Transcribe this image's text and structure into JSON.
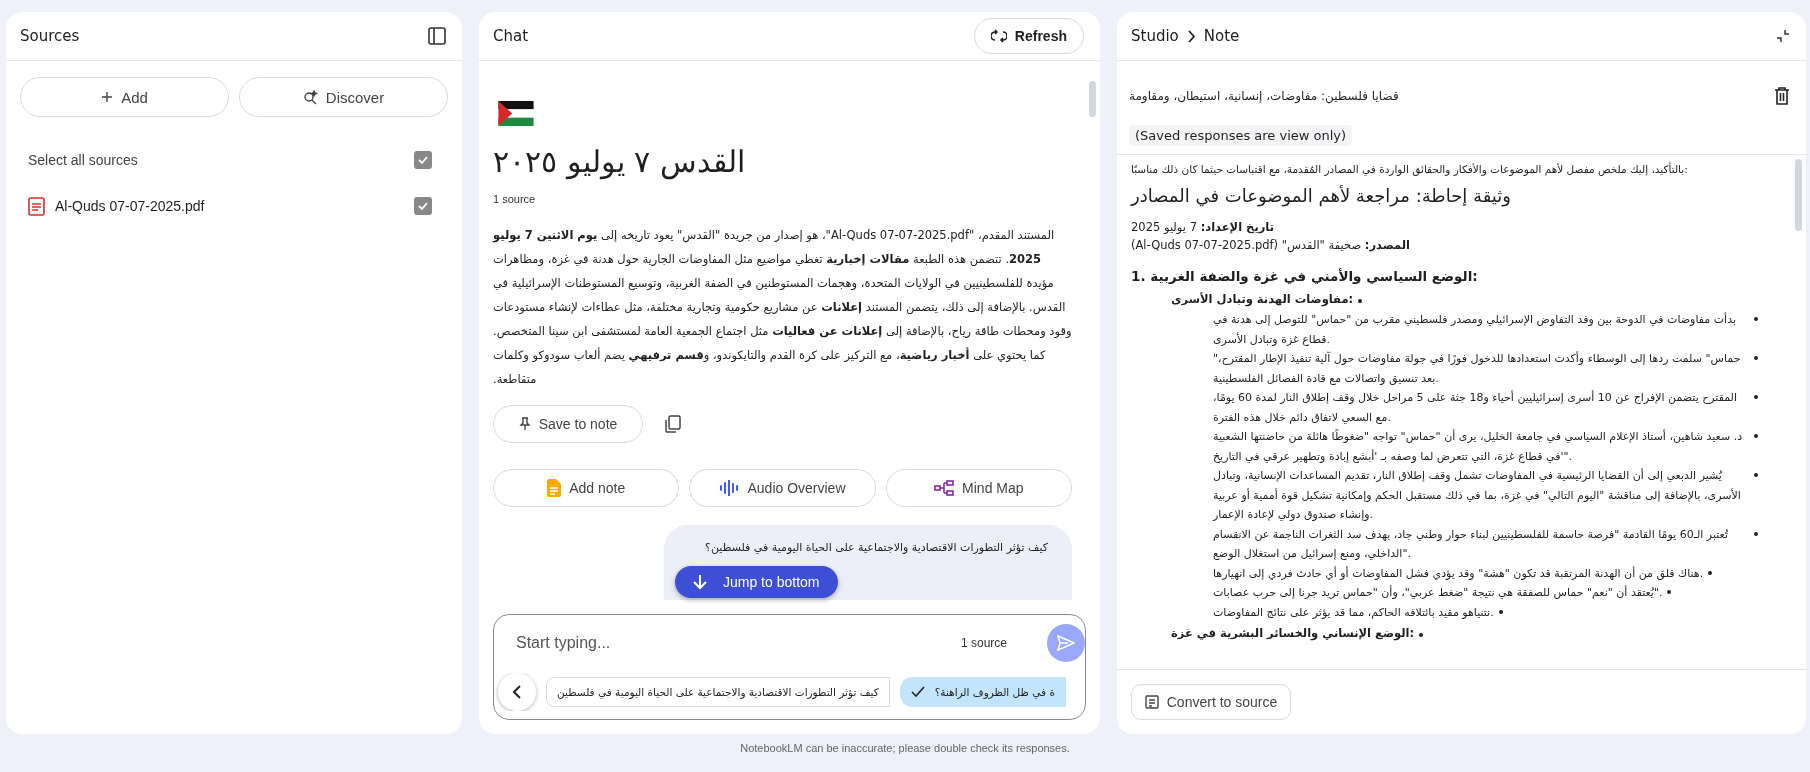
{
  "sources_panel": {
    "title": "Sources",
    "add_button": "Add",
    "discover_button": "Discover",
    "select_all": {
      "label": "Select all sources",
      "checked": true
    },
    "sources": [
      {
        "name": "Al-Quds 07-07-2025.pdf",
        "checked": true
      }
    ]
  },
  "chat": {
    "title": "Chat",
    "refresh_button": "Refresh",
    "message": {
      "title": "القدس ٧ يوليو ٢٠٢٥",
      "source_count": "1 source",
      "summary": "المستند المقدم، \"Al-Quds 07-07-2025.pdf\"، هو إصدار من جريدة \"القدس\" يعود تاريخه إلى **يوم الاثنين 7 يوليو 2025**. تتضمن هذه الطبعة **مقالات إخبارية** تغطي مواضيع مثل المفاوضات الجارية حول هدنة في غزة، ومظاهرات مؤيدة للفلسطينيين في الولايات المتحدة، وهجمات المستوطنين في الضفة الغربية، وتوسيع المستوطنات الإسرائيلية في القدس. بالإضافة إلى ذلك، يتضمن المستند **إعلانات** عن مشاريع حكومية وتجارية مختلفة، مثل عطاءات لإنشاء مستودعات وقود ومحطات طاقة رياح، بالإضافة إلى **إعلانات عن فعاليات** مثل اجتماع الجمعية العامة لمستشفى ابن سينا المتخصص. كما يحتوي على **أخبار رياضية**، مع التركيز على كرة القدم والتايكوندو، و**قسم ترفيهي** يضم ألعاب سودوكو وكلمات متقاطعة.",
      "save_button": "Save to note"
    },
    "add_note_button": "Add note",
    "audio_overview_button": "Audio Overview",
    "mind_map_button": "Mind Map",
    "user_message": "كيف تؤثر التطورات الاقتصادية والاجتماعية على الحياة اليومية في فلسطين؟",
    "jump_button": "Jump to bottom",
    "input": {
      "placeholder": "Start typing...",
      "source_count": "1 source"
    },
    "suggestion_left": {
      "text": "كيف تؤثر التطورات الاقتصادية والاجتماعية على الحياة اليومية في فلسطين",
      "selected": false
    },
    "suggestion_right": {
      "text": "ة في ظل الظروف الراهنة؟",
      "selected": true
    }
  },
  "studio": {
    "breadcrumb_parent": "Studio",
    "breadcrumb_current": "Note",
    "note_title": "قضايا فلسطين: مفاوضات، إنسانية، استيطان، ومقاومة",
    "view_only_label": "(Saved responses are view only)",
    "content": [
      {
        "kind": "intro",
        "text": "بالتأكيد، إليك ملخص مفصل لأهم الموضوعات والأفكار والحقائق الواردة في المصادر المُقدمة، مع اقتباسات حيثما كان ذلك مناسبًا:"
      },
      {
        "kind": "heading",
        "text": "وثيقة إحاطة: مراجعة لأهم الموضوعات في المصادر"
      },
      {
        "kind": "meta",
        "text": "**تاريخ الإعداد:** 7 يوليو 2025"
      },
      {
        "kind": "meta",
        "text": "**المصدر:** صحيفة \"القدس\" (Al-Quds 07-07-2025.pdf)"
      },
      {
        "kind": "section",
        "text": "1. الوضع السياسي والأمني في غزة والضفة الغربية:",
        "children": [
          {
            "kind": "subsection",
            "text": "مفاوضات الهدنة وتبادل الأسرى:",
            "children": [
              {
                "kind": "item",
                "text": "بدأت مفاوضات في الدوحة بين وفد التفاوض الإسرائيلي ومصدر فلسطيني مقرب من \"حماس\" للتوصل إلى هدنة في قطاع غزة وتبادل الأسرى."
              },
              {
                "kind": "item",
                "text": "\"حماس\" سلمت ردها إلى الوسطاء وأكدت استعدادها للدخول فورًا في جولة مفاوضات حول آلية تنفيذ الإطار المقترح، بعد تنسيق واتصالات مع قادة الفصائل الفلسطينية."
              },
              {
                "kind": "item",
                "text": "المقترح يتضمن الإفراج عن 10 أسرى إسرائيليين أحياء و18 جثة على 5 مراحل خلال وقف إطلاق النار لمدة 60 يومًا، مع السعي لاتفاق دائم خلال هذه الفترة."
              },
              {
                "kind": "item",
                "text": "د. سعيد شاهين، أستاذ الإعلام السياسي في جامعة الخليل، يرى أن \"حماس\" تواجه \"ضغوطًا هائلة من حاضنتها الشعبية في قطاع غزة، التي تتعرض لما وصفه بـ 'أبشع إبادة وتطهير عرقي في التاريخ'\"."
              },
              {
                "kind": "item",
                "text": "يُشير الدبعي إلى أن القضايا الرئيسية في المفاوضات تشمل وقف إطلاق النار، تقديم المساعدات الإنسانية، وتبادل الأسرى، بالإضافة إلى مناقشة \"اليوم التالي\" في غزة، بما في ذلك مستقبل الحكم وإمكانية تشكيل قوة أممية أو عربية وإنشاء صندوق دولي لإعادة الإعمار."
              },
              {
                "kind": "item",
                "text": "تُعتبر الـ60 يومًا القادمة \"فرصة حاسمة للفلسطينيين لبناء حوار وطني جاد، بهدف سد الثغرات الناجمة عن الانقسام الداخلي، ومنع إسرائيل من استغلال الوضع\"."
              },
              {
                "kind": "item",
                "text": "هناك قلق من أن الهدنة المرتقبة قد تكون \"هشة\" وقد يؤدي فشل المفاوضات أو أي حادث فردي إلى انهيارها."
              },
              {
                "kind": "item",
                "text": "يُعتقد أن \"نعم\" حماس للصفقة هي نتيجة \"ضغط عربي\"، وأن \"حماس تريد جرنا إلى حرب عصابات\"."
              },
              {
                "kind": "item",
                "text": "نتنياهو مقيد بائتلافه الحاكم، مما قد يؤثر على نتائج المفاوضات."
              }
            ]
          },
          {
            "kind": "subsection",
            "text": "الوضع الإنساني والخسائر البشرية في غزة:"
          }
        ]
      }
    ],
    "convert_button": "Convert to source"
  },
  "footer": "NotebookLM can be inaccurate; please double check its responses."
}
